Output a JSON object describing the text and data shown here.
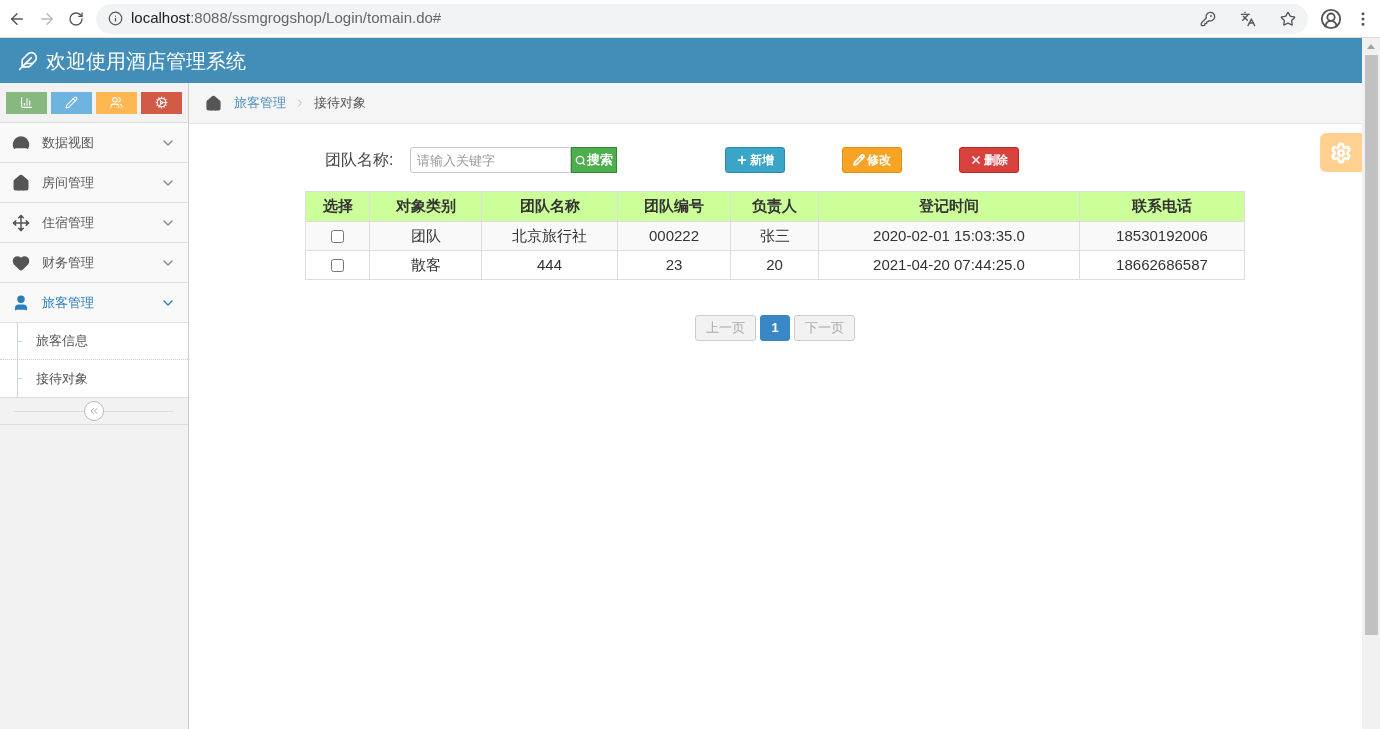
{
  "browser": {
    "url_host": "localhost",
    "url_rest": ":8088/ssmgrogshop/Login/tomain.do#"
  },
  "header": {
    "title": "欢迎使用酒店管理系统"
  },
  "shortcuts": [
    {
      "kind": "chart",
      "color": "#87b87f"
    },
    {
      "kind": "pencil",
      "color": "#6fb3e0"
    },
    {
      "kind": "users",
      "color": "#ffb752"
    },
    {
      "kind": "cogs",
      "color": "#d15b47"
    }
  ],
  "menu": [
    {
      "kind": "dashboard",
      "label": "数据视图",
      "expanded": false,
      "selected": false
    },
    {
      "kind": "home",
      "label": "房间管理",
      "expanded": false,
      "selected": false
    },
    {
      "kind": "move",
      "label": "住宿管理",
      "expanded": false,
      "selected": false
    },
    {
      "kind": "heart",
      "label": "财务管理",
      "expanded": false,
      "selected": false
    },
    {
      "kind": "user",
      "label": "旅客管理",
      "expanded": true,
      "selected": true,
      "children": [
        {
          "label": "旅客信息"
        },
        {
          "label": "接待对象"
        }
      ]
    }
  ],
  "breadcrumb": [
    {
      "label": "旅客管理",
      "kind": "link"
    },
    {
      "label": "接待对象",
      "kind": "current"
    }
  ],
  "search": {
    "label": "团队名称:",
    "placeholder": "请输入关键字",
    "button": "搜索"
  },
  "actions": [
    {
      "kind": "add",
      "label": "新增"
    },
    {
      "kind": "edit",
      "label": "修改"
    },
    {
      "kind": "delete",
      "label": "删除"
    }
  ],
  "table": {
    "columns": [
      "选择",
      "对象类别",
      "团队名称",
      "团队编号",
      "负责人",
      "登记时间",
      "联系电话"
    ],
    "rows": [
      {
        "checked": false,
        "cells": [
          "",
          "团队",
          "北京旅行社",
          "000222",
          "张三",
          "2020-02-01 15:03:35.0",
          "18530192006"
        ]
      },
      {
        "checked": false,
        "cells": [
          "",
          "散客",
          "444",
          "23",
          "20",
          "2021-04-20 07:44:25.0",
          "18662686587"
        ]
      }
    ]
  },
  "pagination": {
    "prev": {
      "label": "上一页",
      "disabled": true
    },
    "pages": [
      {
        "label": "1",
        "selected": true
      }
    ],
    "next": {
      "label": "下一页",
      "disabled": true
    }
  }
}
